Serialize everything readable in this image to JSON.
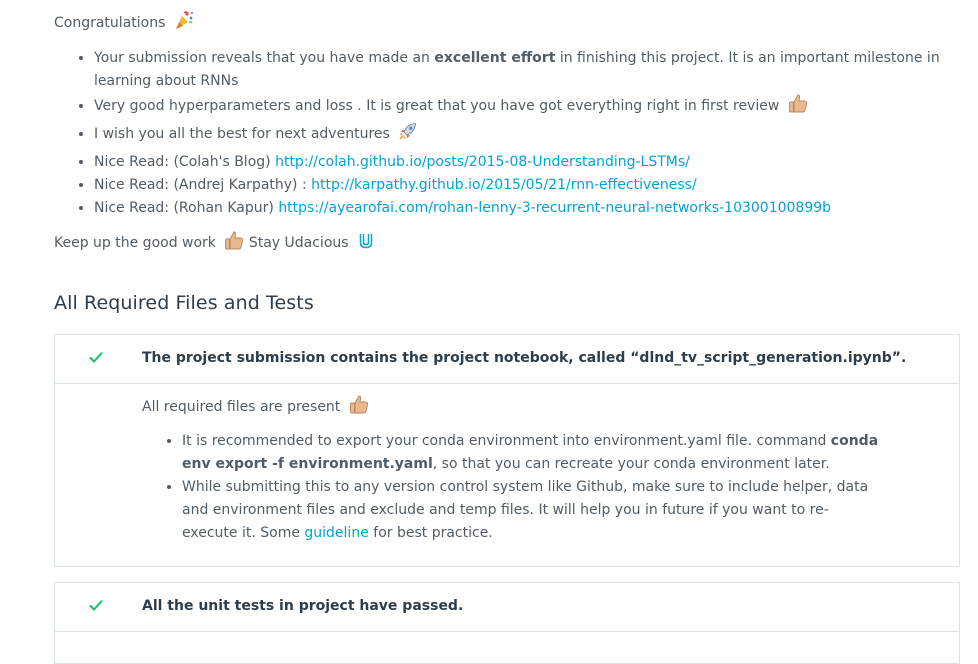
{
  "review": {
    "congrats_text": "Congratulations",
    "bullets": [
      {
        "before": "Your submission reveals that you have made an ",
        "bold": "excellent effort",
        "after": " in finishing this project. It is an important milestone in learning about RNNs"
      },
      {
        "text": "Very good hyperparameters and loss . It is great that you have got everything right in first review"
      },
      {
        "text": "I wish you all the best for next adventures"
      }
    ],
    "reads": [
      {
        "label": "Nice Read: (Colah's Blog) ",
        "link": "http://colah.github.io/posts/2015-08-Understanding-LSTMs/"
      },
      {
        "label": "Nice Read: (Andrej Karpathy) : ",
        "link": "http://karpathy.github.io/2015/05/21/rnn-effectiveness/"
      },
      {
        "label": "Nice Read: (Rohan Kapur) ",
        "link": "https://ayearofai.com/rohan-lenny-3-recurrent-neural-networks-10300100899b"
      }
    ],
    "keepup_a": "Keep up the good work",
    "keepup_b": "Stay Udacious"
  },
  "section": {
    "title": "All Required Files and Tests",
    "criteria": [
      {
        "title": "The project submission contains the project notebook, called “dlnd_tv_script_generation.ipynb”.",
        "intro": "All required files are present",
        "b1_before": "It is recommended to export your conda environment into environment.yaml file. command ",
        "b1_bold": "conda env export -f environment.yaml",
        "b1_after": ", so that you can recreate your conda environment later.",
        "b2_before": "While submitting this to any version control system like Github, make sure to include helper, data and environment files and exclude and temp files. It will help you in future if you want to re-execute it. Some ",
        "b2_link": "guideline",
        "b2_after": " for best practice."
      },
      {
        "title": "All the unit tests in project have passed."
      }
    ]
  },
  "colors": {
    "link": "#02a3d6",
    "check": "#15c26b",
    "heading": "#2e3d49",
    "text": "#525c65"
  }
}
